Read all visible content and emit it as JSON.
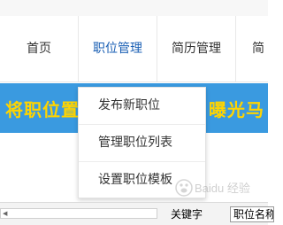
{
  "nav": {
    "items": [
      {
        "label": "首页"
      },
      {
        "label": "职位管理",
        "active": true
      },
      {
        "label": "简历管理"
      },
      {
        "label": "简"
      }
    ]
  },
  "banner": {
    "left_text": "将职位置",
    "right_text": "曝光马",
    "background_color": "#3a9ae0",
    "text_color": "#ffd400"
  },
  "dropdown": {
    "items": [
      {
        "label": "发布新职位"
      },
      {
        "label": "管理职位列表"
      },
      {
        "label": "设置职位模板"
      }
    ]
  },
  "search": {
    "keyword_label": "关键字",
    "select_value": "职位名称"
  },
  "watermark": {
    "text": "Baidu 经验"
  },
  "colors": {
    "accent": "#1a5fb4"
  }
}
